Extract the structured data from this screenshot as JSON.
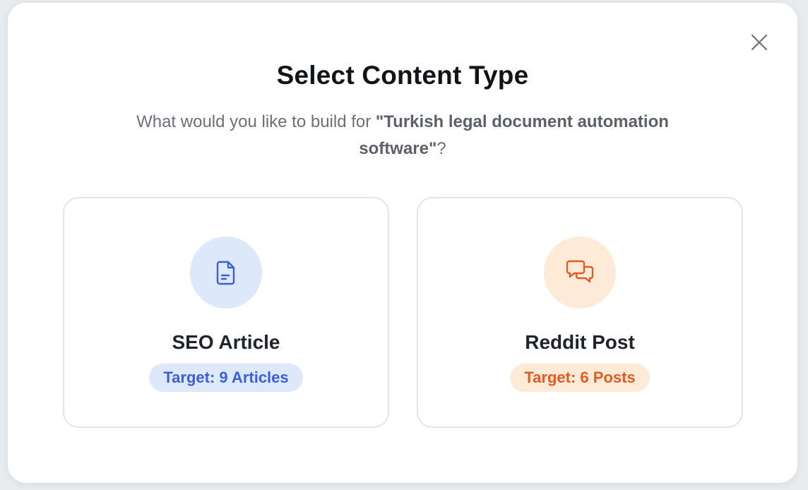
{
  "modal": {
    "title": "Select Content Type",
    "subtitle_prefix": "What would you like to build for ",
    "topic": "\"Turkish legal document automation software\"",
    "subtitle_suffix": "?"
  },
  "options": [
    {
      "name": "SEO Article",
      "target": "Target: 9 Articles",
      "icon": "document-icon",
      "accent": "#3b5fd9",
      "icon_bg": "#dde8fb",
      "badge_bg": "#dde8fb"
    },
    {
      "name": "Reddit Post",
      "target": "Target: 6 Posts",
      "icon": "chat-bubbles-icon",
      "accent": "#e25a26",
      "icon_bg": "#fdebd8",
      "badge_bg": "#fdebd8"
    }
  ],
  "close_icon": "close-icon"
}
